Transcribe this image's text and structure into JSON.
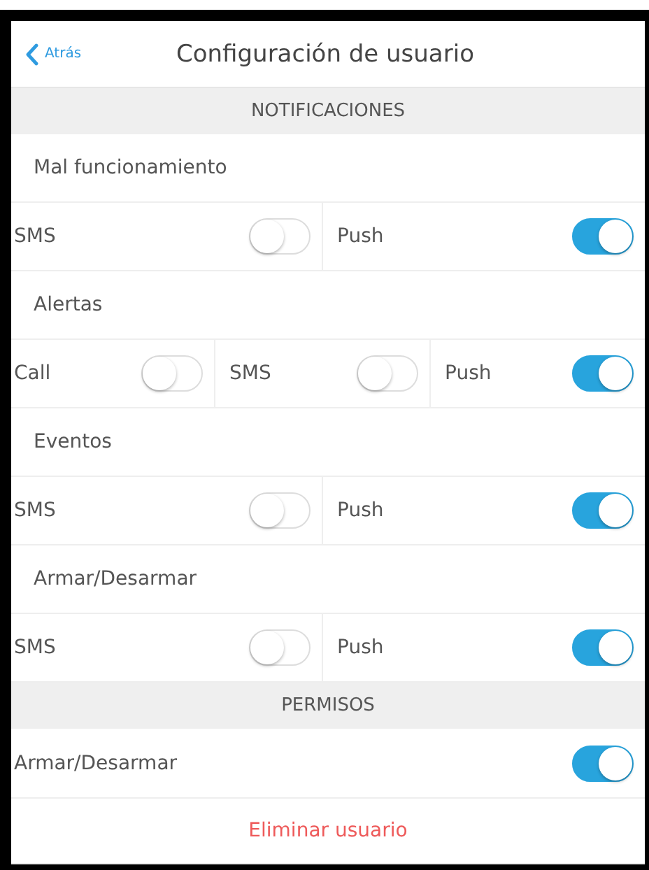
{
  "header": {
    "back_label": "Atrás",
    "title": "Configuración de usuario"
  },
  "sections": [
    {
      "title": "NOTIFICACIONES",
      "items": [
        {
          "kind": "group",
          "title": "Mal funcionamiento",
          "toggles": [
            {
              "label": "SMS",
              "on": false
            },
            {
              "label": "Push",
              "on": true
            }
          ]
        },
        {
          "kind": "group",
          "title": "Alertas",
          "toggles": [
            {
              "label": "Call",
              "on": false
            },
            {
              "label": "SMS",
              "on": false
            },
            {
              "label": "Push",
              "on": true
            }
          ]
        },
        {
          "kind": "group",
          "title": "Eventos",
          "toggles": [
            {
              "label": "SMS",
              "on": false
            },
            {
              "label": "Push",
              "on": true
            }
          ]
        },
        {
          "kind": "group",
          "title": "Armar/Desarmar",
          "toggles": [
            {
              "label": "SMS",
              "on": false
            },
            {
              "label": "Push",
              "on": true
            }
          ]
        }
      ]
    },
    {
      "title": "PERMISOS",
      "items": [
        {
          "kind": "switch",
          "label": "Armar/Desarmar",
          "on": true
        }
      ]
    }
  ],
  "delete_button": "Eliminar usuario"
}
